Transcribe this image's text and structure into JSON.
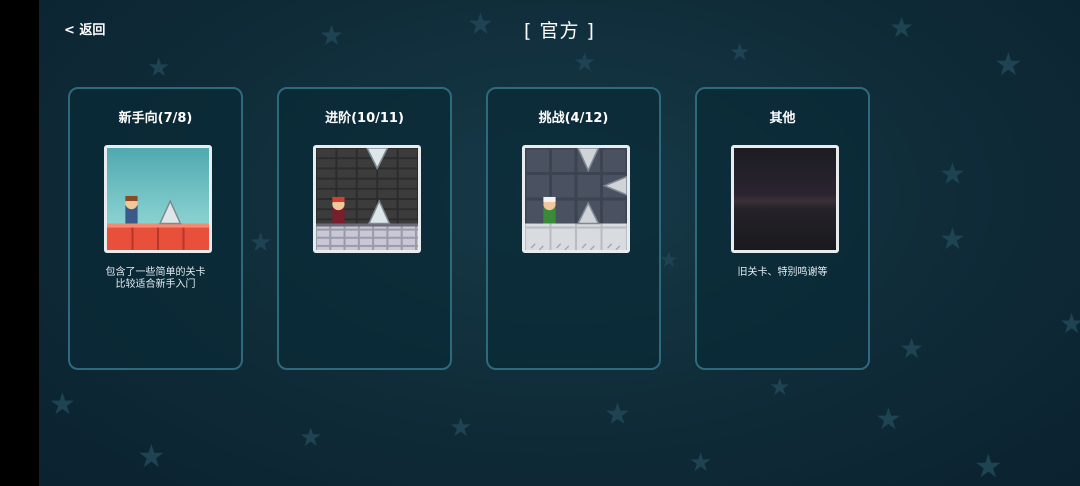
{
  "nav": {
    "back_label": "< 返回"
  },
  "header": {
    "title": "[ 官方 ]"
  },
  "colors": {
    "card_border": "#2d6a7d",
    "background": "#0f2b38",
    "star": "#1e4352"
  },
  "cards": [
    {
      "title": "新手向(7/8)",
      "desc_line1": "包含了一些简单的关卡",
      "desc_line2": "比较适合新手入门",
      "thumb": "level-preview-beginner"
    },
    {
      "title": "进阶(10/11)",
      "desc_line1": "",
      "desc_line2": "",
      "thumb": "level-preview-advanced"
    },
    {
      "title": "挑战(4/12)",
      "desc_line1": "",
      "desc_line2": "",
      "thumb": "level-preview-challenge"
    },
    {
      "title": "其他",
      "desc_line1": "旧关卡、特别鸣谢等",
      "desc_line2": "",
      "thumb": "level-preview-other"
    }
  ]
}
